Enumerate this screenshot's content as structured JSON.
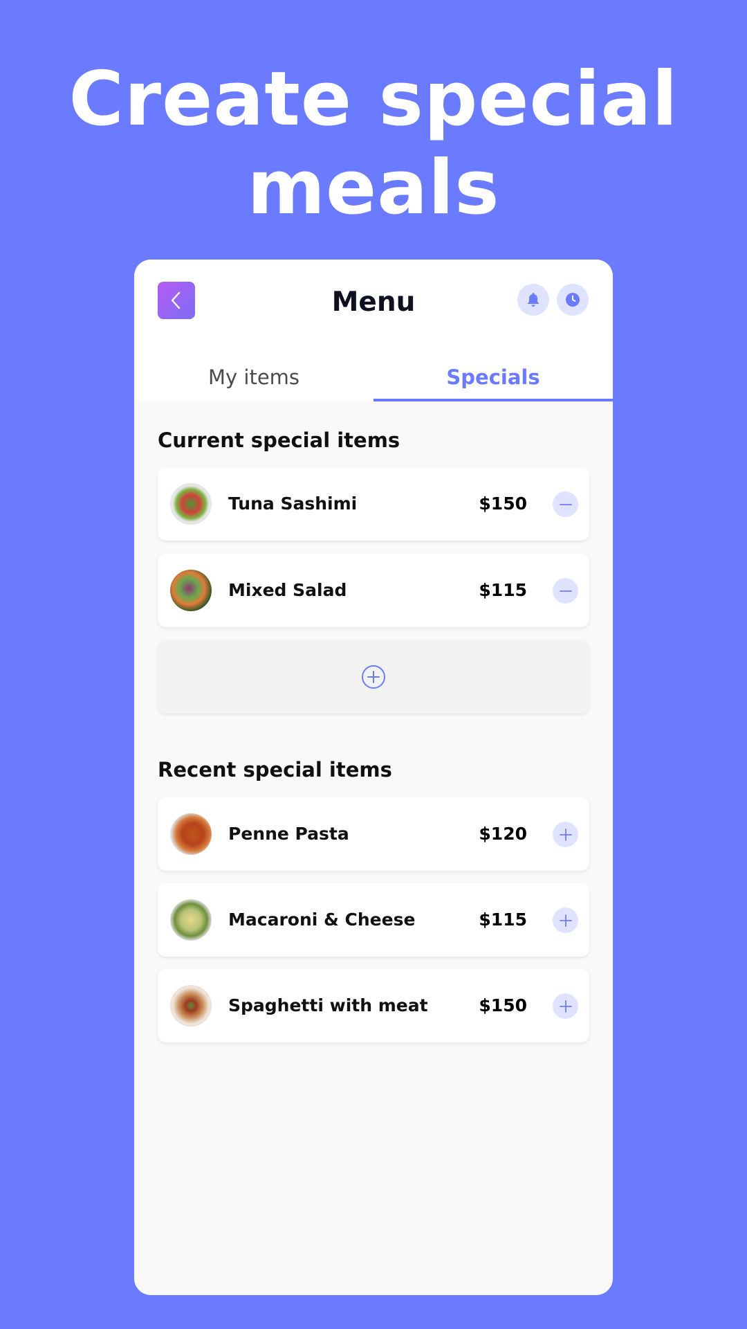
{
  "headline": {
    "line1": "Create special",
    "line2": "meals"
  },
  "header": {
    "title": "Menu",
    "back_icon": "chevron-left-icon",
    "notification_icon": "bell-icon",
    "history_icon": "clock-icon"
  },
  "tabs": [
    {
      "label": "My items",
      "active": false
    },
    {
      "label": "Specials",
      "active": true
    }
  ],
  "current_section": {
    "title": "Current special items",
    "items": [
      {
        "name": "Tuna Sashimi",
        "price": "$150",
        "action": "minus"
      },
      {
        "name": "Mixed Salad",
        "price": "$115",
        "action": "minus"
      }
    ],
    "add_icon": "plus-circle-icon"
  },
  "recent_section": {
    "title": "Recent special items",
    "items": [
      {
        "name": "Penne Pasta",
        "price": "$120",
        "action": "plus"
      },
      {
        "name": "Macaroni & Cheese",
        "price": "$115",
        "action": "plus"
      },
      {
        "name": "Spaghetti with meat",
        "price": "$150",
        "action": "plus"
      }
    ]
  },
  "colors": {
    "background": "#6b7bff",
    "accent": "#6b7bff",
    "button_tint": "#dfe3ff",
    "back_gradient_start": "#b35cf2",
    "back_gradient_end": "#7f6df6"
  }
}
